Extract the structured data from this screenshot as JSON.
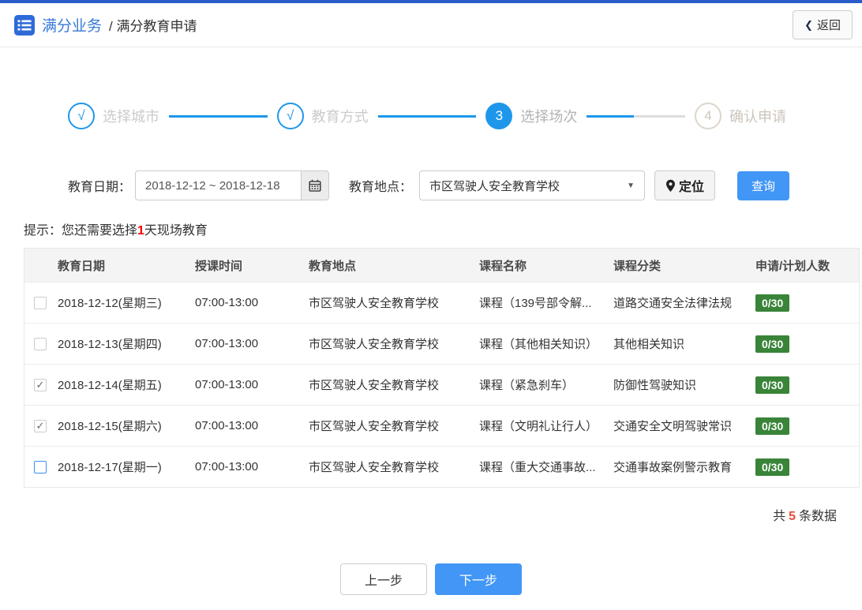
{
  "colors": {
    "topbar": "#2a5bc7",
    "brand-blue": "#3779d6",
    "step-blue": "#1e97ea",
    "button-blue": "#4296f5",
    "badge-green": "#398439",
    "highlight-red": "#ff0000",
    "count-red": "#e74c3c"
  },
  "header": {
    "title_primary": "满分业务",
    "title_secondary": "/ 满分教育申请",
    "back_chevron": "❮",
    "back_label": "返回"
  },
  "steps": [
    {
      "marker": "√",
      "label": "选择城市",
      "state": "done"
    },
    {
      "marker": "√",
      "label": "教育方式",
      "state": "done"
    },
    {
      "marker": "3",
      "label": "选择场次",
      "state": "active"
    },
    {
      "marker": "4",
      "label": "确认申请",
      "state": "pending"
    }
  ],
  "filters": {
    "date_label": "教育日期：",
    "date_value": "2018-12-12 ~ 2018-12-18",
    "location_label": "教育地点：",
    "location_value": "市区驾驶人安全教育学校",
    "location_caret": "▼",
    "locate_label": "定位",
    "search_label": "查询"
  },
  "hint": {
    "prefix": "提示：您还需要选择",
    "highlight": "1",
    "suffix": "天现场教育"
  },
  "table": {
    "columns": [
      "教育日期",
      "授课时间",
      "教育地点",
      "课程名称",
      "课程分类",
      "申请/计划人数"
    ],
    "rows": [
      {
        "checkbox_state": "unchecked",
        "date": "2018-12-12(星期三)",
        "time": "07:00-13:00",
        "location": "市区驾驶人安全教育学校",
        "course": "课程（139号部令解...",
        "category": "道路交通安全法律法规",
        "count": "0/30"
      },
      {
        "checkbox_state": "unchecked",
        "date": "2018-12-13(星期四)",
        "time": "07:00-13:00",
        "location": "市区驾驶人安全教育学校",
        "course": "课程（其他相关知识）",
        "category": "其他相关知识",
        "count": "0/30"
      },
      {
        "checkbox_state": "checked",
        "date": "2018-12-14(星期五)",
        "time": "07:00-13:00",
        "location": "市区驾驶人安全教育学校",
        "course": "课程（紧急刹车）",
        "category": "防御性驾驶知识",
        "count": "0/30"
      },
      {
        "checkbox_state": "checked",
        "date": "2018-12-15(星期六)",
        "time": "07:00-13:00",
        "location": "市区驾驶人安全教育学校",
        "course": "课程（文明礼让行人）",
        "category": "交通安全文明驾驶常识",
        "count": "0/30"
      },
      {
        "checkbox_state": "unchecked-active",
        "date": "2018-12-17(星期一)",
        "time": "07:00-13:00",
        "location": "市区驾驶人安全教育学校",
        "course": "课程（重大交通事故...",
        "category": "交通事故案例警示教育",
        "count": "0/30"
      }
    ]
  },
  "summary": {
    "prefix": "共",
    "count": "5",
    "suffix": "条数据"
  },
  "actions": {
    "prev_label": "上一步",
    "next_label": "下一步"
  }
}
